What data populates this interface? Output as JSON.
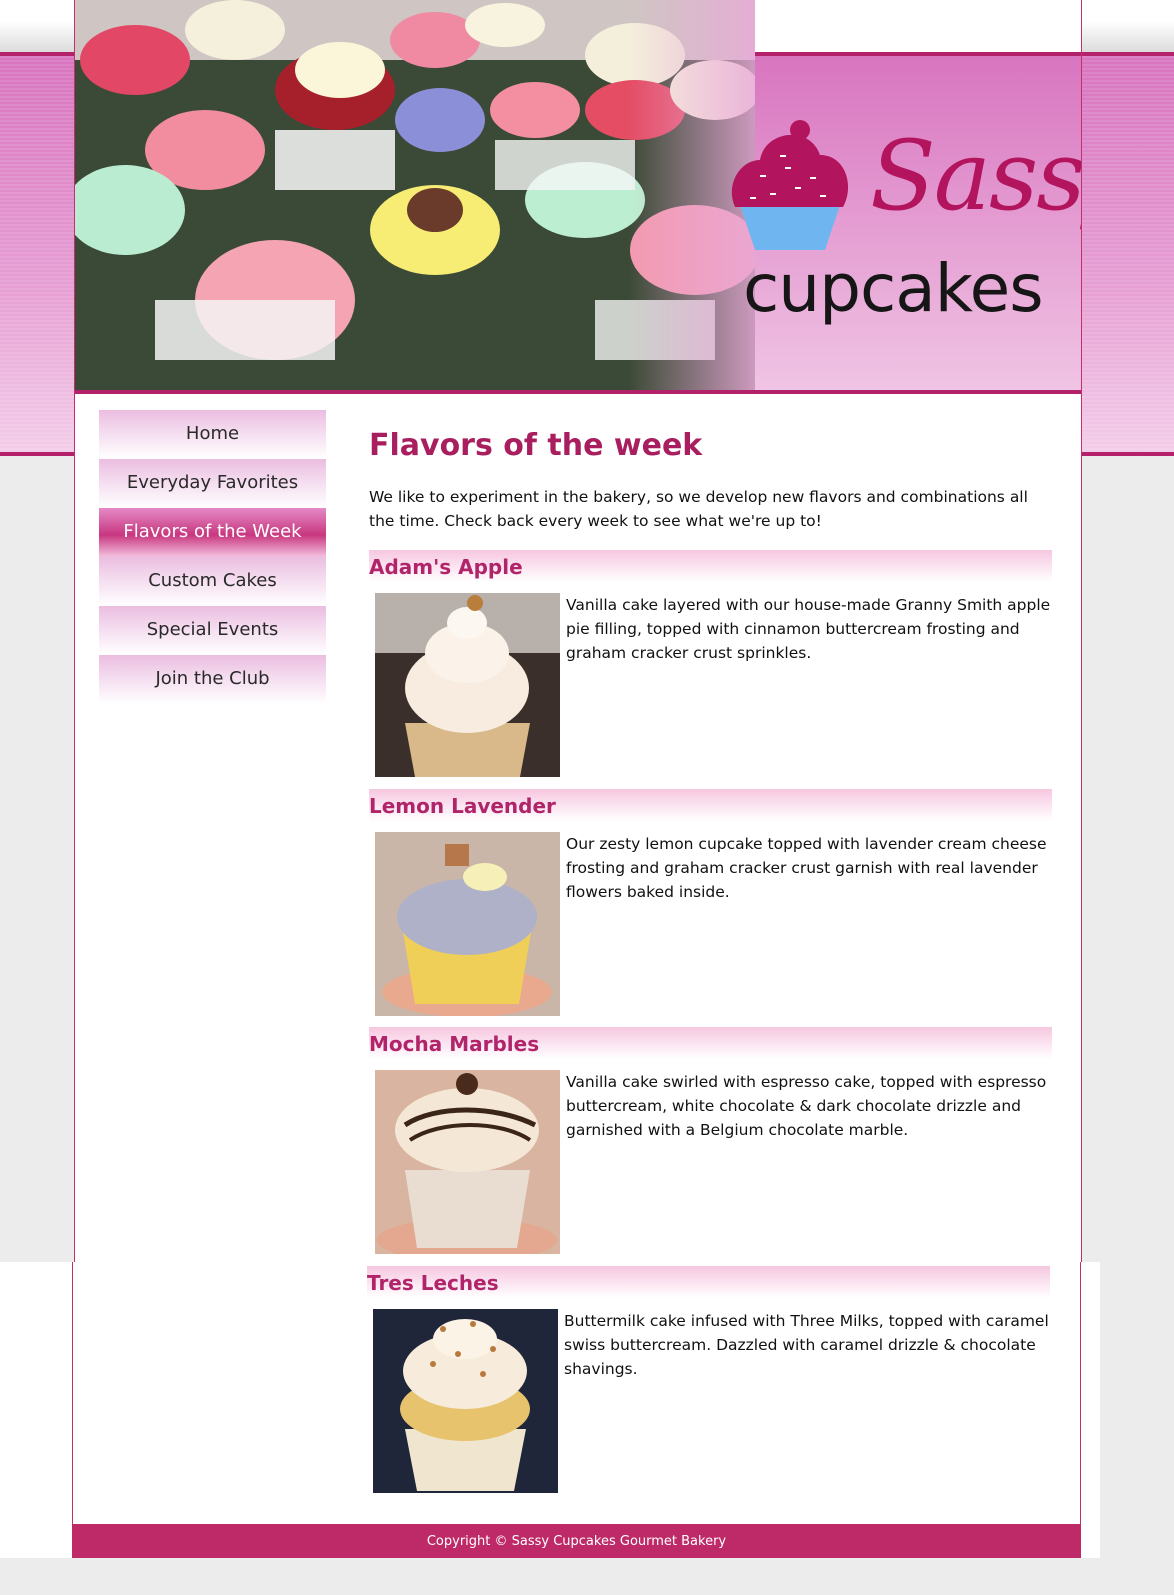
{
  "brand": {
    "logo_line1": "Sassy",
    "logo_line2": "cupcakes",
    "accent_color": "#b2216a"
  },
  "nav": {
    "items": [
      {
        "label": "Home",
        "active": false
      },
      {
        "label": "Everyday Favorites",
        "active": false
      },
      {
        "label": "Flavors of the Week",
        "active": true
      },
      {
        "label": "Custom Cakes",
        "active": false
      },
      {
        "label": "Special Events",
        "active": false
      },
      {
        "label": "Join the Club",
        "active": false
      }
    ]
  },
  "main": {
    "title": "Flavors of the week",
    "intro": "We like to experiment in the bakery, so we develop new flavors and combinations all the time. Check back every week to see what we're up to!",
    "flavors": [
      {
        "name": "Adam's Apple",
        "description": "Vanilla cake layered with our house-made Granny Smith apple pie filling, topped with cinnamon buttercream frosting and graham cracker crust sprinkles."
      },
      {
        "name": "Lemon Lavender",
        "description": "Our zesty lemon cupcake topped with lavender cream cheese frosting and graham cracker crust garnish with real lavender flowers baked inside."
      },
      {
        "name": "Mocha Marbles",
        "description": "Vanilla cake swirled with espresso cake, topped with espresso buttercream, white chocolate & dark chocolate drizzle and garnished with a Belgium chocolate marble."
      },
      {
        "name": "Tres Leches",
        "description": "Buttermilk cake infused with Three Milks, topped with caramel swiss buttercream. Dazzled with caramel drizzle & chocolate shavings."
      }
    ]
  },
  "footer": {
    "copyright": "Copyright © Sassy Cupcakes Gourmet Bakery"
  }
}
